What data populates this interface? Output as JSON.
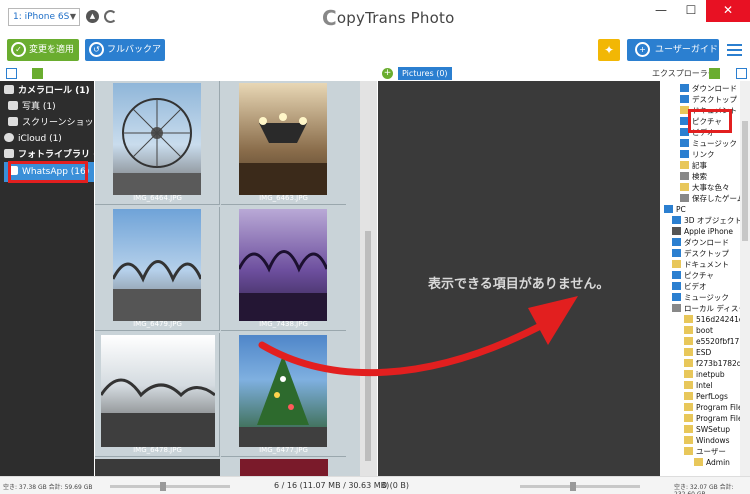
{
  "titlebar": {
    "device": "1: iPhone 6S",
    "app_title": "CopyTrans Photo",
    "logo_letter": "C",
    "app_title_rest": "opyTrans Photo"
  },
  "toolbar": {
    "apply_label": "変更を適用",
    "backup_label": "フルバックアップ",
    "guide_label": "ユーザーガイド"
  },
  "subbar": {
    "pictures_tab": "Pictures (0)",
    "explorer_label": "エクスプローラー"
  },
  "sidebar": {
    "items": [
      {
        "label": "カメラロール (1)",
        "bold": true
      },
      {
        "label": "写真 (1)",
        "bold": false
      },
      {
        "label": "スクリーンショッ...",
        "bold": false
      },
      {
        "label": "iCloud (1)",
        "bold": false
      },
      {
        "label": "フォトライブラリ (45)",
        "bold": true
      },
      {
        "label": "WhatsApp (16)",
        "bold": false
      }
    ]
  },
  "photos": [
    {
      "caption": "IMG_6464.JPG"
    },
    {
      "caption": "IMG_6463.JPG"
    },
    {
      "caption": "IMG_6479.JPG"
    },
    {
      "caption": "IMG_7438.JPG"
    },
    {
      "caption": "IMG_6478.JPG"
    },
    {
      "caption": "IMG_6477.JPG"
    }
  ],
  "main": {
    "empty_message": "表示できる項目がありません。"
  },
  "tree": {
    "nodes": [
      {
        "label": "ダウンロード",
        "color": "#2b7fd0"
      },
      {
        "label": "デスクトップ",
        "color": "#2b7fd0"
      },
      {
        "label": "ドキュメント",
        "color": "#e8c75a"
      },
      {
        "label": "ピクチャ",
        "color": "#2b7fd0"
      },
      {
        "label": "ビデオ",
        "color": "#2b7fd0"
      },
      {
        "label": "ミュージック",
        "color": "#2b7fd0"
      },
      {
        "label": "リンク",
        "color": "#2b7fd0"
      },
      {
        "label": "記事",
        "color": "#e8c75a"
      },
      {
        "label": "検索",
        "color": "#888888"
      },
      {
        "label": "大事な色々",
        "color": "#e8c75a"
      },
      {
        "label": "保存したゲーム",
        "color": "#888888"
      },
      {
        "label": "PC",
        "color": "#2b7fd0"
      },
      {
        "label": "3D オブジェクト",
        "color": "#2b7fd0"
      },
      {
        "label": "Apple iPhone",
        "color": "#555555"
      },
      {
        "label": "ダウンロード",
        "color": "#2b7fd0"
      },
      {
        "label": "デスクトップ",
        "color": "#2b7fd0"
      },
      {
        "label": "ドキュメント",
        "color": "#e8c75a"
      },
      {
        "label": "ピクチャ",
        "color": "#2b7fd0"
      },
      {
        "label": "ビデオ",
        "color": "#2b7fd0"
      },
      {
        "label": "ミュージック",
        "color": "#2b7fd0"
      },
      {
        "label": "ローカル ディスク",
        "color": "#888888"
      },
      {
        "label": "516d24241d",
        "color": "#e8c75a"
      },
      {
        "label": "boot",
        "color": "#e8c75a"
      },
      {
        "label": "e5520fbf17",
        "color": "#e8c75a"
      },
      {
        "label": "ESD",
        "color": "#e8c75a"
      },
      {
        "label": "f273b1782d",
        "color": "#e8c75a"
      },
      {
        "label": "inetpub",
        "color": "#e8c75a"
      },
      {
        "label": "Intel",
        "color": "#e8c75a"
      },
      {
        "label": "PerfLogs",
        "color": "#e8c75a"
      },
      {
        "label": "Program File",
        "color": "#e8c75a"
      },
      {
        "label": "Program File",
        "color": "#e8c75a"
      },
      {
        "label": "SWSetup",
        "color": "#e8c75a"
      },
      {
        "label": "Windows",
        "color": "#e8c75a"
      },
      {
        "label": "ユーザー",
        "color": "#e8c75a"
      },
      {
        "label": "Admin",
        "color": "#e8c75a"
      }
    ]
  },
  "statusbar": {
    "left_storage": "空き: 37.38 GB 合計: 59.69 GB",
    "center_count": "6 / 16 (11.07 MB / 30.63 MB)",
    "right_count": "0 (0 B)",
    "right_storage": "空き: 32.07 GB 合計: 232.60 GB"
  },
  "colors": {
    "accent_blue": "#2b7fd0",
    "apply_green": "#6aad2f",
    "highlight_red": "#e21f1f",
    "close_red": "#e81123"
  }
}
